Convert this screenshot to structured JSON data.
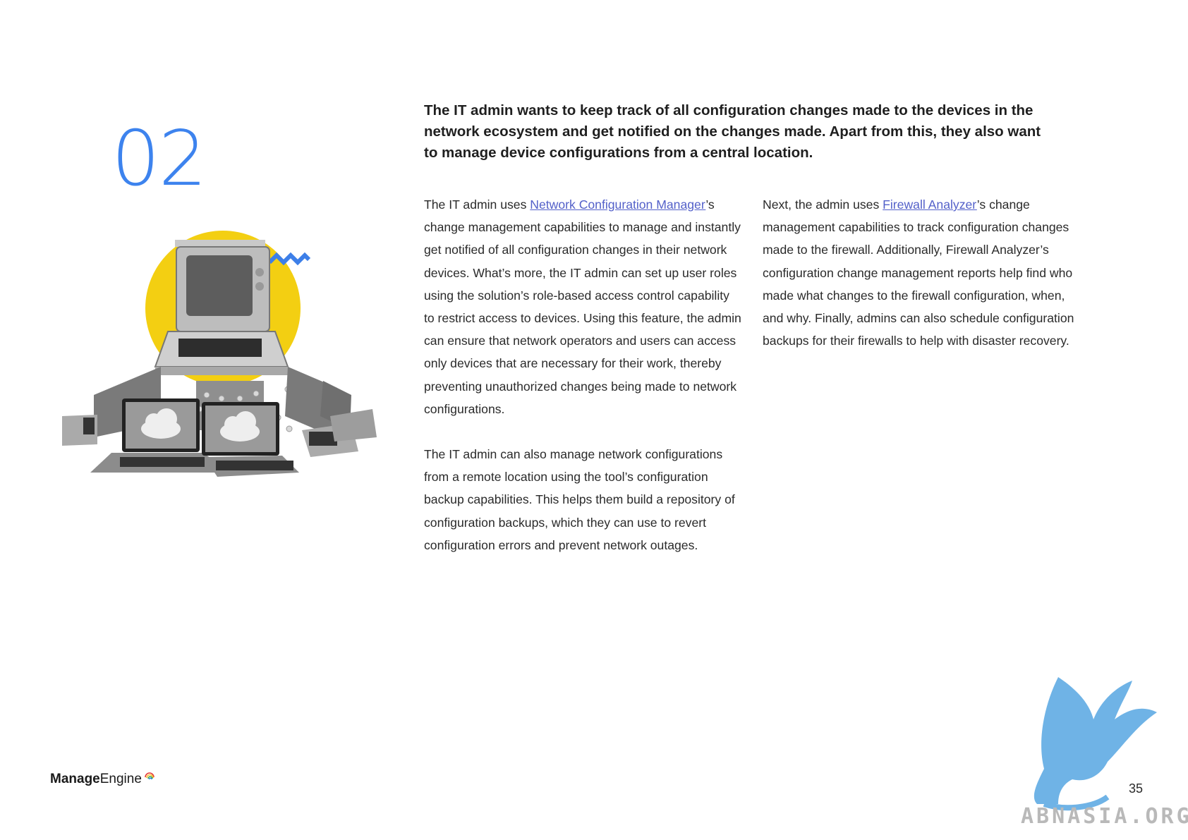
{
  "section": {
    "number": "02"
  },
  "headline": "The IT admin wants to keep track of all configuration changes made to the devices in the network ecosystem and get notified on the changes made. Apart from this, they also want to manage device configurations from a central location.",
  "left_column": {
    "p1_before": "The IT admin uses ",
    "p1_link": "Network Configuration Manager",
    "p1_after": "’s change management capabilities to manage and instantly get notified of all configuration changes in their network devices. What’s more, the IT admin can set up user roles using the solution’s role-based access control capability to restrict access to devices. Using this feature, the admin can ensure that network operators and users can access only devices that are necessary for their work, thereby preventing unauthorized changes being made to network configurations.",
    "p2": "The IT admin can also manage network configurations from a remote location using the tool’s configuration backup capabilities. This helps them build a repository of configuration backups, which they can use to revert configuration errors and prevent network outages."
  },
  "right_column": {
    "p1_before": "Next, the admin uses ",
    "p1_link": "Firewall Analyzer",
    "p1_after": "’s change management capabilities to track configuration changes made to the firewall. Additionally, Firewall Analyzer’s configuration change management reports help find who made what changes to the firewall configuration, when, and why. Finally, admins can also schedule configuration backups for their firewalls to help with disaster recovery."
  },
  "footer": {
    "brand_bold": "Manage",
    "brand_regular": "Engine",
    "page_number": "35"
  },
  "watermark": {
    "text": "ABNASIA.ORG"
  },
  "colors": {
    "accent_blue": "#3d83ee",
    "link": "#5360c9",
    "yellow": "#f3cf12",
    "watermark_blue": "#6fb3e6"
  },
  "icons": [
    "retro-computer-icon",
    "laptop-icon",
    "cloud-icon",
    "zigzag-icon",
    "griffin-watermark-icon"
  ]
}
